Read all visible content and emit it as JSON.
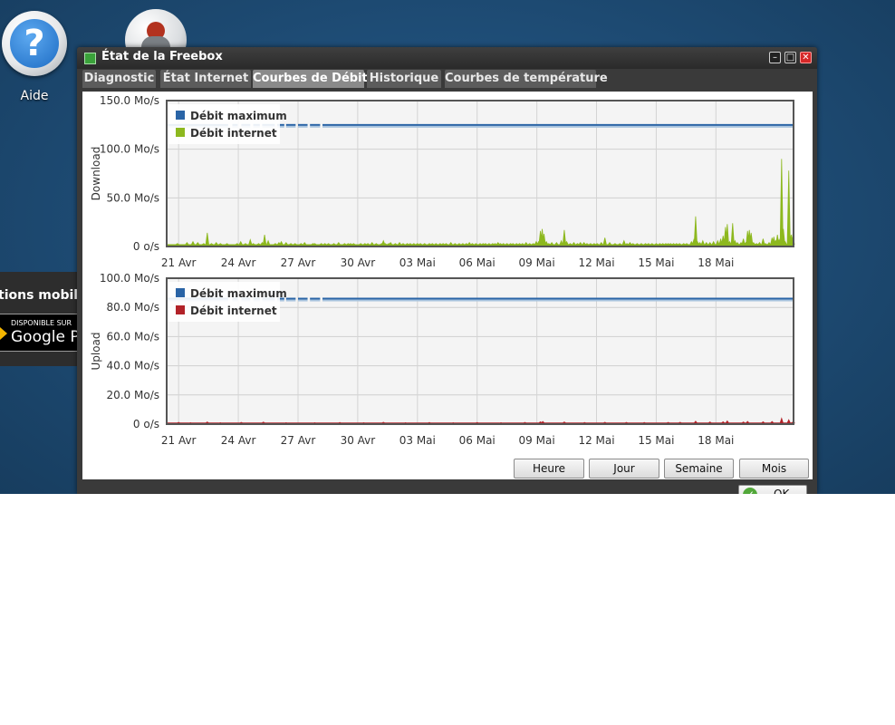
{
  "desktop": {
    "help_label": "Aide",
    "help_glyph": "?",
    "side_text": "tions mobile",
    "store_small": "DISPONIBLE SUR",
    "store_big": "Google Pla"
  },
  "window": {
    "title": "État de la Freebox",
    "tabs": [
      "Diagnostic",
      "État Internet",
      "Courbes de Débit",
      "Historique",
      "Courbes de température"
    ],
    "active_tab": "Courbes de Débit",
    "range_buttons": [
      "Heure",
      "Jour",
      "Semaine",
      "Mois"
    ],
    "ok_label": "OK"
  },
  "colors": {
    "max": "#2a64a6",
    "download": "#8db81e",
    "upload": "#b22228"
  },
  "chart_data": [
    {
      "type": "area",
      "ylabel": "Download",
      "ylim": [
        0,
        150
      ],
      "y_ticks": [
        {
          "v": 0,
          "label": "0 o/s"
        },
        {
          "v": 50,
          "label": "50.0 Mo/s"
        },
        {
          "v": 100,
          "label": "100.0 Mo/s"
        },
        {
          "v": 150,
          "label": "150.0 Mo/s"
        }
      ],
      "x_ticks": [
        "21 Avr",
        "24 Avr",
        "27 Avr",
        "30 Avr",
        "03 Mai",
        "06 Mai",
        "09 Mai",
        "12 Mai",
        "15 Mai",
        "18 Mai"
      ],
      "x_start": "19 Avr",
      "legend": [
        "Débit maximum",
        "Débit internet"
      ],
      "max_value": 125,
      "max_gaps": [
        [
          10.3,
          11.0
        ],
        [
          11.9,
          12.5
        ],
        [
          14.0,
          14.5
        ],
        [
          15.6,
          16.0
        ],
        [
          18.1,
          18.5
        ],
        [
          19.7,
          20.0
        ],
        [
          21.6,
          22.0
        ],
        [
          23.6,
          24.0
        ],
        [
          25.7,
          26.1
        ]
      ],
      "baseline": 2,
      "spikes": [
        [
          1.8,
          3
        ],
        [
          2.7,
          2
        ],
        [
          3.4,
          4
        ],
        [
          4.4,
          5
        ],
        [
          5.2,
          4
        ],
        [
          6.2,
          3
        ],
        [
          6.8,
          14
        ],
        [
          7.5,
          3
        ],
        [
          8.3,
          4
        ],
        [
          9.0,
          3
        ],
        [
          10.1,
          3
        ],
        [
          11.0,
          2
        ],
        [
          11.8,
          3
        ],
        [
          12.4,
          5
        ],
        [
          13.2,
          3
        ],
        [
          14.0,
          7
        ],
        [
          14.5,
          3
        ],
        [
          15.4,
          3
        ],
        [
          16.0,
          4
        ],
        [
          16.4,
          12
        ],
        [
          17.0,
          6
        ],
        [
          18.2,
          3
        ],
        [
          18.8,
          4
        ],
        [
          19.2,
          5
        ],
        [
          20.0,
          4
        ],
        [
          20.8,
          3
        ],
        [
          21.5,
          3
        ],
        [
          22.5,
          3
        ],
        [
          23.1,
          4
        ],
        [
          23.6,
          2
        ],
        [
          24.5,
          3
        ],
        [
          24.8,
          3
        ],
        [
          25.9,
          3
        ],
        [
          26.5,
          3
        ],
        [
          27.1,
          3
        ],
        [
          28.0,
          3
        ],
        [
          28.8,
          4
        ],
        [
          29.8,
          3
        ],
        [
          30.4,
          3
        ],
        [
          30.8,
          3
        ],
        [
          31.3,
          3
        ],
        [
          31.7,
          2
        ],
        [
          32.5,
          3
        ],
        [
          33.2,
          3
        ],
        [
          33.7,
          3
        ],
        [
          34.4,
          4
        ],
        [
          35.1,
          3
        ],
        [
          36.0,
          3
        ],
        [
          36.3,
          6
        ],
        [
          36.6,
          3
        ],
        [
          37.2,
          3
        ],
        [
          37.5,
          4
        ],
        [
          38.3,
          3
        ],
        [
          39.0,
          4
        ],
        [
          39.6,
          3
        ],
        [
          40.3,
          3
        ],
        [
          40.8,
          3
        ],
        [
          41.4,
          3
        ],
        [
          42.0,
          3
        ],
        [
          42.5,
          3
        ],
        [
          43.2,
          3
        ],
        [
          44.0,
          3
        ],
        [
          44.5,
          3
        ],
        [
          45.1,
          3
        ],
        [
          45.8,
          3
        ],
        [
          46.3,
          3
        ],
        [
          46.8,
          3
        ],
        [
          47.6,
          4
        ],
        [
          48.3,
          3
        ],
        [
          49.0,
          3
        ],
        [
          49.6,
          3
        ],
        [
          50.2,
          3
        ],
        [
          50.7,
          4
        ],
        [
          51.2,
          3
        ],
        [
          51.8,
          3
        ],
        [
          52.5,
          3
        ],
        [
          53.0,
          3
        ],
        [
          53.4,
          3
        ],
        [
          54.0,
          3
        ],
        [
          54.6,
          3
        ],
        [
          55.0,
          3
        ],
        [
          55.5,
          4
        ],
        [
          55.9,
          3
        ],
        [
          56.4,
          3
        ],
        [
          57.0,
          3
        ],
        [
          57.6,
          3
        ],
        [
          58.0,
          3
        ],
        [
          58.6,
          3
        ],
        [
          59.1,
          3
        ],
        [
          59.6,
          3
        ],
        [
          60.2,
          4
        ],
        [
          60.8,
          3
        ],
        [
          61.4,
          3
        ],
        [
          61.9,
          5
        ],
        [
          62.3,
          5
        ],
        [
          62.6,
          16
        ],
        [
          62.9,
          18
        ],
        [
          63.2,
          13
        ],
        [
          63.6,
          5
        ],
        [
          64.0,
          3
        ],
        [
          64.5,
          4
        ],
        [
          65.3,
          4
        ],
        [
          66.1,
          6
        ],
        [
          66.6,
          17
        ],
        [
          67.0,
          5
        ],
        [
          67.6,
          3
        ],
        [
          68.2,
          4
        ],
        [
          68.8,
          3
        ],
        [
          69.3,
          4
        ],
        [
          69.9,
          4
        ],
        [
          70.4,
          3
        ],
        [
          71.0,
          3
        ],
        [
          71.6,
          3
        ],
        [
          72.1,
          3
        ],
        [
          72.8,
          4
        ],
        [
          73.4,
          9
        ],
        [
          74.2,
          4
        ],
        [
          75.1,
          3
        ],
        [
          75.9,
          3
        ],
        [
          76.6,
          6
        ],
        [
          77.1,
          3
        ],
        [
          77.6,
          4
        ],
        [
          78.1,
          3
        ],
        [
          78.8,
          3
        ],
        [
          79.5,
          3
        ],
        [
          80.2,
          3
        ],
        [
          80.7,
          3
        ],
        [
          81.3,
          3
        ],
        [
          82.0,
          3
        ],
        [
          82.6,
          3
        ],
        [
          83.1,
          3
        ],
        [
          83.6,
          3
        ],
        [
          84.0,
          3
        ],
        [
          84.4,
          3
        ],
        [
          84.9,
          3
        ],
        [
          85.4,
          3
        ],
        [
          85.9,
          3
        ],
        [
          86.6,
          3
        ],
        [
          87.1,
          3
        ],
        [
          87.9,
          5
        ],
        [
          88.3,
          7
        ],
        [
          88.6,
          31
        ],
        [
          88.9,
          5
        ],
        [
          89.3,
          4
        ],
        [
          89.8,
          6
        ],
        [
          90.4,
          4
        ],
        [
          91.0,
          4
        ],
        [
          91.6,
          5
        ],
        [
          92.3,
          6
        ],
        [
          92.8,
          8
        ],
        [
          93.2,
          11
        ],
        [
          93.6,
          20
        ],
        [
          93.9,
          23
        ],
        [
          94.3,
          5
        ],
        [
          94.8,
          24
        ],
        [
          95.2,
          6
        ],
        [
          95.6,
          4
        ],
        [
          96.2,
          4
        ],
        [
          96.6,
          8
        ],
        [
          97.0,
          4
        ],
        [
          97.3,
          16
        ],
        [
          97.6,
          17
        ],
        [
          97.9,
          14
        ],
        [
          98.3,
          4
        ],
        [
          98.8,
          3
        ],
        [
          99.3,
          4
        ],
        [
          99.9,
          8
        ],
        [
          100.3,
          3
        ],
        [
          100.9,
          4
        ],
        [
          101.4,
          9
        ],
        [
          101.7,
          10
        ],
        [
          102.0,
          6
        ],
        [
          102.3,
          12
        ],
        [
          102.6,
          7
        ],
        [
          103.0,
          90
        ],
        [
          103.3,
          18
        ],
        [
          103.6,
          5
        ],
        [
          104.2,
          78
        ],
        [
          104.6,
          12
        ],
        [
          104.9,
          13
        ]
      ]
    },
    {
      "type": "area",
      "ylabel": "Upload",
      "ylim": [
        0,
        100
      ],
      "y_ticks": [
        {
          "v": 0,
          "label": "0 o/s"
        },
        {
          "v": 20,
          "label": "20.0 Mo/s"
        },
        {
          "v": 40,
          "label": "40.0 Mo/s"
        },
        {
          "v": 60,
          "label": "60.0 Mo/s"
        },
        {
          "v": 80,
          "label": "80.0 Mo/s"
        },
        {
          "v": 100,
          "label": "100.0 Mo/s"
        }
      ],
      "x_ticks": [
        "21 Avr",
        "24 Avr",
        "27 Avr",
        "30 Avr",
        "03 Mai",
        "06 Mai",
        "09 Mai",
        "12 Mai",
        "15 Mai",
        "18 Mai"
      ],
      "x_start": "19 Avr",
      "legend": [
        "Débit maximum",
        "Débit internet"
      ],
      "max_value": 86,
      "max_gaps": [
        [
          10.3,
          11.0
        ],
        [
          11.9,
          12.5
        ],
        [
          14.0,
          14.5
        ],
        [
          15.6,
          16.0
        ],
        [
          18.1,
          18.5
        ],
        [
          19.7,
          20.0
        ],
        [
          21.6,
          22.0
        ],
        [
          23.6,
          24.0
        ],
        [
          25.7,
          26.1
        ]
      ],
      "baseline": 0.8,
      "spikes": [
        [
          2.0,
          1.2
        ],
        [
          4.0,
          1.0
        ],
        [
          6.8,
          1.5
        ],
        [
          9.0,
          1.0
        ],
        [
          12.5,
          1.2
        ],
        [
          16.2,
          1.4
        ],
        [
          20.0,
          1.0
        ],
        [
          24.8,
          1.0
        ],
        [
          29.0,
          1.1
        ],
        [
          33.0,
          1.0
        ],
        [
          36.3,
          1.3
        ],
        [
          40.0,
          1.0
        ],
        [
          44.0,
          1.1
        ],
        [
          48.0,
          1.0
        ],
        [
          52.0,
          1.1
        ],
        [
          56.0,
          1.0
        ],
        [
          60.0,
          1.2
        ],
        [
          62.6,
          1.6
        ],
        [
          63.0,
          1.8
        ],
        [
          66.6,
          1.5
        ],
        [
          70.0,
          1.1
        ],
        [
          73.4,
          1.3
        ],
        [
          77.0,
          1.2
        ],
        [
          80.0,
          1.1
        ],
        [
          84.0,
          1.2
        ],
        [
          86.0,
          1.3
        ],
        [
          88.6,
          2.0
        ],
        [
          91.0,
          1.5
        ],
        [
          93.2,
          1.6
        ],
        [
          93.9,
          2.2
        ],
        [
          96.6,
          1.5
        ],
        [
          97.3,
          1.9
        ],
        [
          99.9,
          1.6
        ],
        [
          101.4,
          1.8
        ],
        [
          103.0,
          4
        ],
        [
          104.2,
          3
        ],
        [
          104.9,
          1.5
        ]
      ]
    }
  ]
}
